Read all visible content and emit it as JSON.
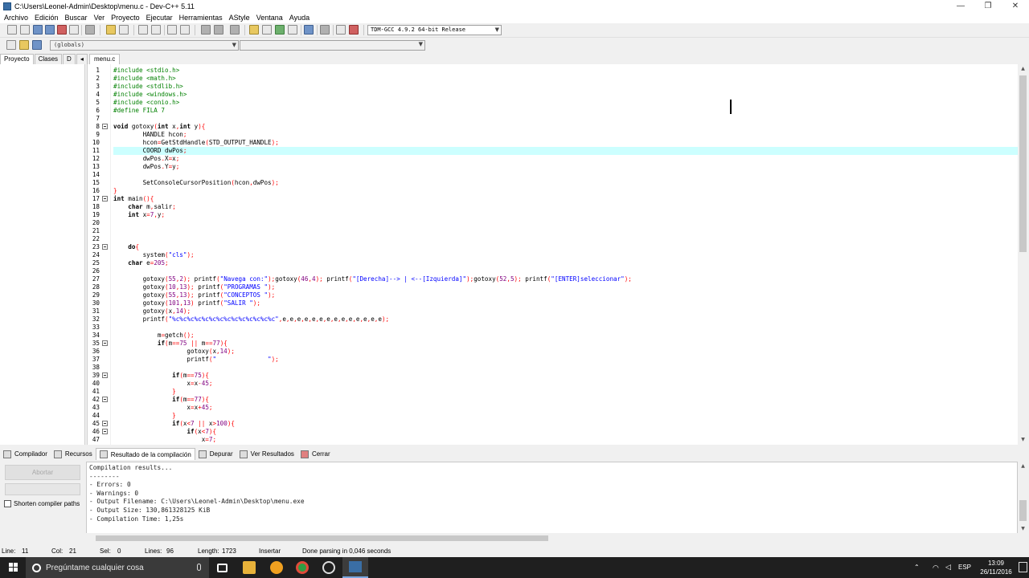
{
  "window": {
    "title": "C:\\Users\\Leonel-Admin\\Desktop\\menu.c - Dev-C++ 5.11",
    "controls": [
      "—",
      "❐",
      "✕"
    ]
  },
  "menu": [
    "Archivo",
    "Edición",
    "Buscar",
    "Ver",
    "Proyecto",
    "Ejecutar",
    "Herramientas",
    "AStyle",
    "Ventana",
    "Ayuda"
  ],
  "toolbar": {
    "compiler": "TDM-GCC 4.9.2 64-bit Release",
    "globals": "(globals)"
  },
  "left_tabs": [
    "Proyecto",
    "Clases",
    "D"
  ],
  "left_tab_arrows": "◂ ▸",
  "editor_tab": "menu.c",
  "code_lines": [
    {
      "n": "1",
      "html": "<span class='c-pre'>#include &lt;stdio.h&gt;</span>"
    },
    {
      "n": "2",
      "html": "<span class='c-pre'>#include &lt;math.h&gt;</span>"
    },
    {
      "n": "3",
      "html": "<span class='c-pre'>#include &lt;stdlib.h&gt;</span>"
    },
    {
      "n": "4",
      "html": "<span class='c-pre'>#include &lt;windows.h&gt;</span>"
    },
    {
      "n": "5",
      "html": "<span class='c-pre'>#include &lt;conio.h&gt;</span>"
    },
    {
      "n": "6",
      "html": "<span class='c-pre'>#define FILA 7</span>"
    },
    {
      "n": "7",
      "html": ""
    },
    {
      "n": "8",
      "fold": true,
      "html": "<span class='c-kw'>void</span> gotoxy<span class='c-sym'>(</span><span class='c-kw'>int</span> x<span class='c-sym'>,</span><span class='c-kw'>int</span> y<span class='c-sym'>){</span>"
    },
    {
      "n": "9",
      "html": "        HANDLE hcon<span class='c-sym'>;</span>"
    },
    {
      "n": "10",
      "html": "        hcon<span class='c-sym'>=</span>GetStdHandle<span class='c-sym'>(</span>STD_OUTPUT_HANDLE<span class='c-sym'>);</span>"
    },
    {
      "n": "11",
      "hl": true,
      "html": "        COORD dwPos<span class='c-sym'>;</span>"
    },
    {
      "n": "12",
      "html": "        dwPos<span class='c-sym'>.</span>X<span class='c-sym'>=</span>x<span class='c-sym'>;</span>"
    },
    {
      "n": "13",
      "html": "        dwPos<span class='c-sym'>.</span>Y<span class='c-sym'>=</span>y<span class='c-sym'>;</span>"
    },
    {
      "n": "14",
      "html": ""
    },
    {
      "n": "15",
      "html": "        SetConsoleCursorPosition<span class='c-sym'>(</span>hcon<span class='c-sym'>,</span>dwPos<span class='c-sym'>);</span>"
    },
    {
      "n": "16",
      "html": "<span class='c-sym'>}</span>"
    },
    {
      "n": "17",
      "fold": true,
      "html": "<span class='c-kw'>int</span> main<span class='c-sym'>(){</span>"
    },
    {
      "n": "18",
      "html": "    <span class='c-kw'>char</span> m<span class='c-sym'>,</span>salir<span class='c-sym'>;</span>"
    },
    {
      "n": "19",
      "html": "    <span class='c-kw'>int</span> x<span class='c-sym'>=</span><span class='c-num'>7</span><span class='c-sym'>,</span>y<span class='c-sym'>;</span>"
    },
    {
      "n": "20",
      "html": ""
    },
    {
      "n": "21",
      "html": ""
    },
    {
      "n": "22",
      "html": ""
    },
    {
      "n": "23",
      "fold": true,
      "html": "    <span class='c-kw'>do</span><span class='c-sym'>{</span>"
    },
    {
      "n": "24",
      "html": "        system<span class='c-sym'>(</span><span class='c-str'>\"cls\"</span><span class='c-sym'>);</span>"
    },
    {
      "n": "25",
      "html": "    <span class='c-kw'>char</span> e<span class='c-sym'>=</span><span class='c-num'>205</span><span class='c-sym'>;</span>"
    },
    {
      "n": "26",
      "html": ""
    },
    {
      "n": "27",
      "html": "        gotoxy<span class='c-sym'>(</span><span class='c-num'>55</span><span class='c-sym'>,</span><span class='c-num'>2</span><span class='c-sym'>);</span> printf<span class='c-sym'>(</span><span class='c-str'>\"Navega con:\"</span><span class='c-sym'>);</span>gotoxy<span class='c-sym'>(</span><span class='c-num'>46</span><span class='c-sym'>,</span><span class='c-num'>4</span><span class='c-sym'>);</span> printf<span class='c-sym'>(</span><span class='c-str'>\"[Derecha]--&gt; | &lt;--[Izquierda]\"</span><span class='c-sym'>);</span>gotoxy<span class='c-sym'>(</span><span class='c-num'>52</span><span class='c-sym'>,</span><span class='c-num'>5</span><span class='c-sym'>);</span> printf<span class='c-sym'>(</span><span class='c-str'>\"[ENTER]seleccionar\"</span><span class='c-sym'>);</span>"
    },
    {
      "n": "28",
      "html": "        gotoxy<span class='c-sym'>(</span><span class='c-num'>10</span><span class='c-sym'>,</span><span class='c-num'>13</span><span class='c-sym'>);</span> printf<span class='c-sym'>(</span><span class='c-str'>\"PROGRAMAS \"</span><span class='c-sym'>);</span>"
    },
    {
      "n": "29",
      "html": "        gotoxy<span class='c-sym'>(</span><span class='c-num'>55</span><span class='c-sym'>,</span><span class='c-num'>13</span><span class='c-sym'>);</span> printf<span class='c-sym'>(</span><span class='c-str'>\"CONCEPTOS \"</span><span class='c-sym'>);</span>"
    },
    {
      "n": "30",
      "html": "        gotoxy<span class='c-sym'>(</span><span class='c-num'>101</span><span class='c-sym'>,</span><span class='c-num'>13</span><span class='c-sym'>)</span> printf<span class='c-sym'>(</span><span class='c-str'>\"SALIR \"</span><span class='c-sym'>);</span>"
    },
    {
      "n": "31",
      "html": "        gotoxy<span class='c-sym'>(</span>x<span class='c-sym'>,</span><span class='c-num'>14</span><span class='c-sym'>);</span>"
    },
    {
      "n": "32",
      "html": "        printf<span class='c-sym'>(</span><span class='c-str'>\"%c%c%c%c%c%c%c%c%c%c%c%c%c%c\"</span><span class='c-sym'>,</span>e<span class='c-sym'>,</span>e<span class='c-sym'>,</span>e<span class='c-sym'>,</span>e<span class='c-sym'>,</span>e<span class='c-sym'>,</span>e<span class='c-sym'>,</span>e<span class='c-sym'>,</span>e<span class='c-sym'>,</span>e<span class='c-sym'>,</span>e<span class='c-sym'>,</span>e<span class='c-sym'>,</span>e<span class='c-sym'>,</span>e<span class='c-sym'>,</span>e<span class='c-sym'>);</span>"
    },
    {
      "n": "33",
      "html": ""
    },
    {
      "n": "34",
      "html": "            m<span class='c-sym'>=</span>getch<span class='c-sym'>();</span>"
    },
    {
      "n": "35",
      "fold": true,
      "html": "            <span class='c-kw'>if</span><span class='c-sym'>(</span>m<span class='c-sym'>==</span><span class='c-num'>75</span> <span class='c-sym'>||</span> m<span class='c-sym'>==</span><span class='c-num'>77</span><span class='c-sym'>){</span>"
    },
    {
      "n": "36",
      "html": "                    gotoxy<span class='c-sym'>(</span>x<span class='c-sym'>,</span><span class='c-num'>14</span><span class='c-sym'>);</span>"
    },
    {
      "n": "37",
      "html": "                    printf<span class='c-sym'>(</span><span class='c-str'>\"              \"</span><span class='c-sym'>);</span>"
    },
    {
      "n": "38",
      "html": ""
    },
    {
      "n": "39",
      "fold": true,
      "html": "                <span class='c-kw'>if</span><span class='c-sym'>(</span>m<span class='c-sym'>==</span><span class='c-num'>75</span><span class='c-sym'>){</span>"
    },
    {
      "n": "40",
      "html": "                    x<span class='c-sym'>=</span>x<span class='c-sym'>-</span><span class='c-num'>45</span><span class='c-sym'>;</span>"
    },
    {
      "n": "41",
      "html": "                <span class='c-sym'>}</span>"
    },
    {
      "n": "42",
      "fold": true,
      "html": "                <span class='c-kw'>if</span><span class='c-sym'>(</span>m<span class='c-sym'>==</span><span class='c-num'>77</span><span class='c-sym'>){</span>"
    },
    {
      "n": "43",
      "html": "                    x<span class='c-sym'>=</span>x<span class='c-sym'>+</span><span class='c-num'>45</span><span class='c-sym'>;</span>"
    },
    {
      "n": "44",
      "html": "                <span class='c-sym'>}</span>"
    },
    {
      "n": "45",
      "fold": true,
      "html": "                <span class='c-kw'>if</span><span class='c-sym'>(</span>x<span class='c-sym'>&lt;</span><span class='c-num'>7</span> <span class='c-sym'>||</span> x<span class='c-sym'>&gt;</span><span class='c-num'>100</span><span class='c-sym'>){</span>"
    },
    {
      "n": "46",
      "fold": true,
      "html": "                    <span class='c-kw'>if</span><span class='c-sym'>(</span>x<span class='c-sym'>&lt;</span><span class='c-num'>7</span><span class='c-sym'>){</span>"
    },
    {
      "n": "47",
      "html": "                        x<span class='c-sym'>=</span><span class='c-num'>7</span><span class='c-sym'>;</span>"
    }
  ],
  "bottom_tabs": [
    "Compilador",
    "Recursos",
    "Resultado de la compilación",
    "Depurar",
    "Ver Resultados",
    "Cerrar"
  ],
  "abort_label": "Abortar",
  "shorten_label": "Shorten compiler paths",
  "output_lines": [
    "Compilation results...",
    "--------",
    "- Errors: 0",
    "- Warnings: 0",
    "- Output Filename: C:\\Users\\Leonel-Admin\\Desktop\\menu.exe",
    "- Output Size: 130,861328125 KiB",
    "- Compilation Time: 1,25s"
  ],
  "status": {
    "line_label": "Line:",
    "line": "11",
    "col_label": "Col:",
    "col": "21",
    "sel_label": "Sel:",
    "sel": "0",
    "lines_label": "Lines:",
    "lines": "96",
    "length_label": "Length:",
    "length": "1723",
    "mode": "Insertar",
    "message": "Done parsing in 0,046 seconds"
  },
  "taskbar": {
    "search_placeholder": "Pregúntame cualquier cosa",
    "lang": "ESP",
    "time": "13:09",
    "date": "26/11/2016"
  }
}
